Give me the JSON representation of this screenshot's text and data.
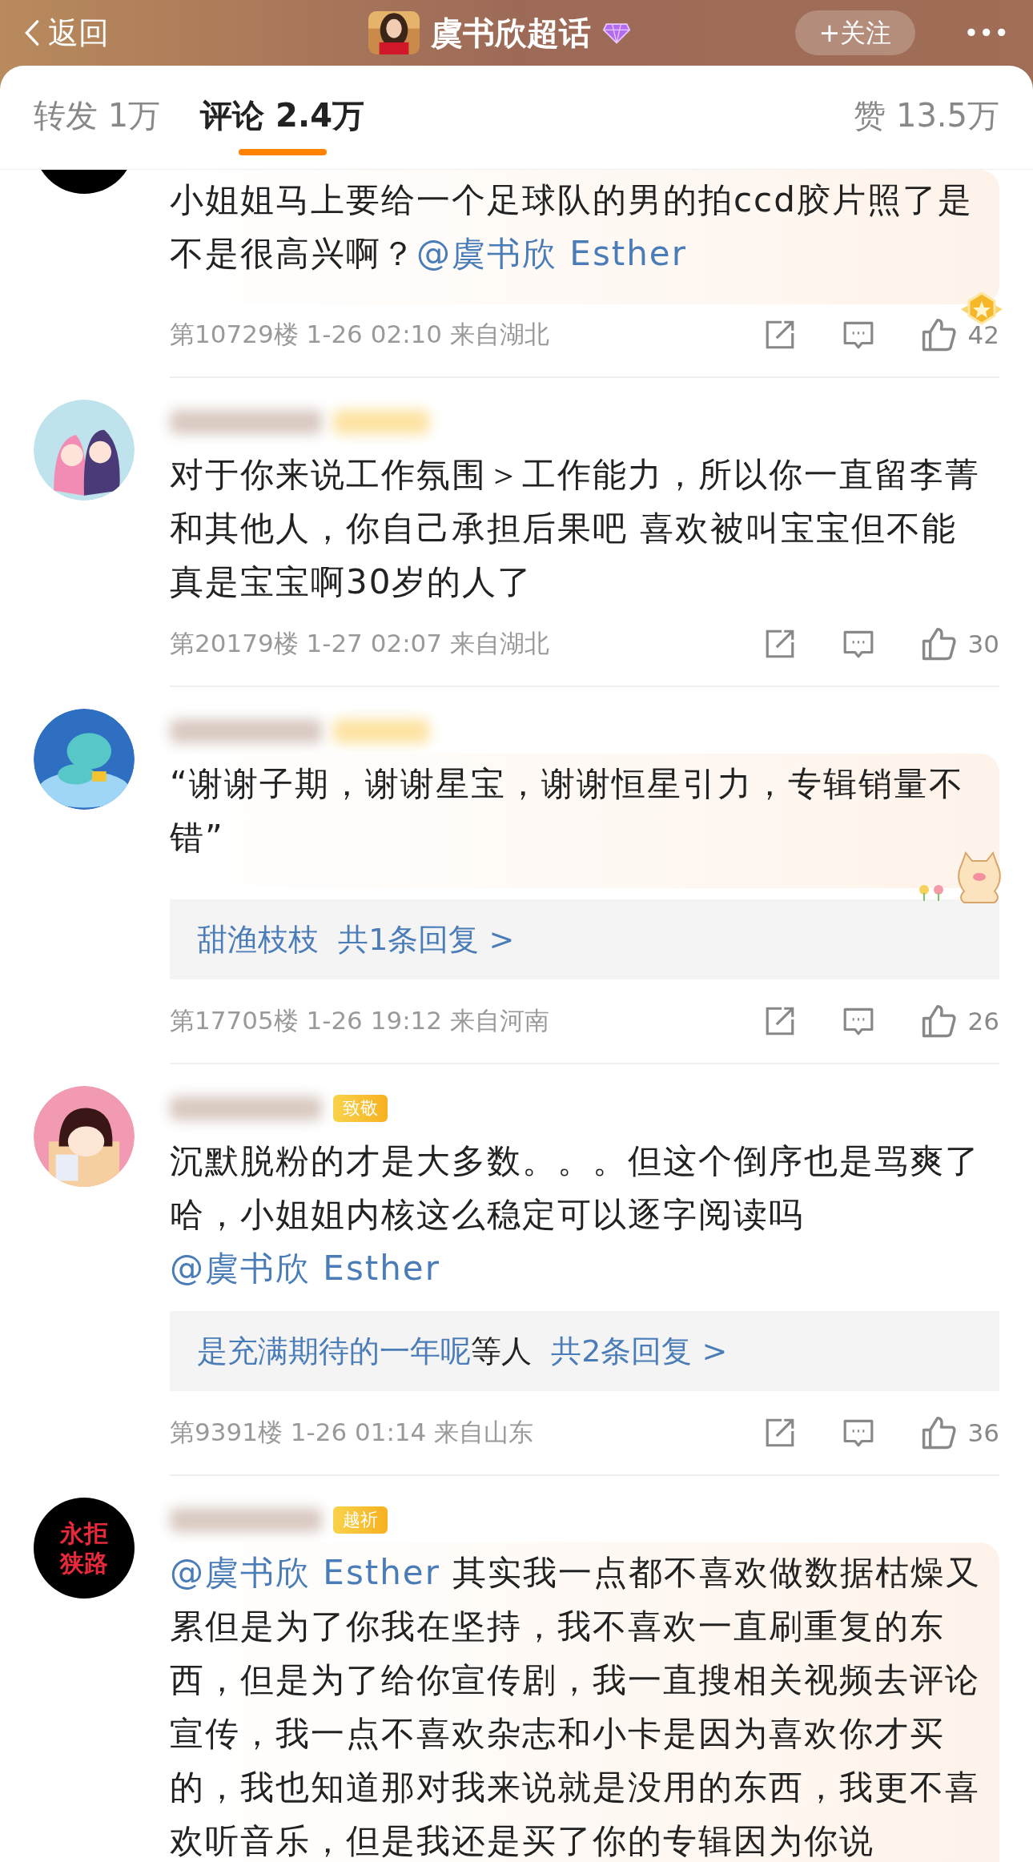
{
  "header": {
    "back_label": "返回",
    "title": "虞书欣超话",
    "follow_label": "+关注",
    "more_label": "•••"
  },
  "tabs": [
    {
      "label": "转发 1万",
      "selected": false
    },
    {
      "label": "评论 2.4万",
      "selected": true
    },
    {
      "label": "赞 13.5万",
      "selected": false
    }
  ],
  "comments": [
    {
      "kind": "scrolled",
      "avatar": {
        "kind": "dark"
      },
      "highlight": true,
      "decoration": {
        "kind": "medal"
      },
      "segments": [
        {
          "kind": "text",
          "text": "小姐姐马上要给一个足球队的男的拍ccd胶片照了是不是很高兴啊？"
        },
        {
          "kind": "mention",
          "text": "@虞书欣 Esther"
        }
      ],
      "meta": "第10729楼 1-26 02:10 来自湖北",
      "likes": "42"
    },
    {
      "kind": "full",
      "avatar": {
        "kind": "anime"
      },
      "highlight": false,
      "segments": [
        {
          "kind": "text",
          "text": "对于你来说工作氛围＞工作能力，所以你一直留李菁和其他人，你自己承担后果吧  喜欢被叫宝宝但不能真是宝宝啊30岁的人了"
        }
      ],
      "meta": "第20179楼 1-27 02:07 来自湖北",
      "likes": "30"
    },
    {
      "kind": "full",
      "avatar": {
        "kind": "blue"
      },
      "highlight": true,
      "decoration": {
        "kind": "cat"
      },
      "segments": [
        {
          "kind": "text",
          "text": "“谢谢子期，谢谢星宝，谢谢恒星引力，专辑销量不错”"
        }
      ],
      "reply": [
        {
          "kind": "link",
          "text": "甜渔枝枝"
        },
        {
          "kind": "link",
          "text": "  共1条回复 >"
        }
      ],
      "meta": "第17705楼 1-26 19:12 来自河南",
      "likes": "26"
    },
    {
      "kind": "full",
      "avatar": {
        "kind": "pink"
      },
      "badge": "致敬",
      "highlight": false,
      "segments": [
        {
          "kind": "text",
          "text": "沉默脱粉的才是大多数。。。但这个倒序也是骂爽了哈，小姐姐内核这么稳定可以逐字阅读吗 "
        },
        {
          "kind": "mention",
          "text": "@虞书欣 Esther"
        }
      ],
      "reply": [
        {
          "kind": "link",
          "text": "是充满期待的一年呢"
        },
        {
          "kind": "text",
          "text": "等人"
        },
        {
          "kind": "link",
          "text": "  共2条回复 >"
        }
      ],
      "meta": "第9391楼 1-26 01:14 来自山东",
      "likes": "36"
    },
    {
      "kind": "full",
      "avatar": {
        "kind": "sign",
        "text": "永拒狭路"
      },
      "badge": "越祈",
      "highlight": true,
      "segments": [
        {
          "kind": "mention",
          "text": "@虞书欣 Esther"
        },
        {
          "kind": "text",
          "text": " 其实我一点都不喜欢做数据枯燥又累但是为了你我在坚持，我不喜欢一直刷重复的东西，但是为了给你宣传剧，我一直搜相关视频去评论宣传，我一点不喜欢杂志和小卡是因为喜欢你才买的，我也知道那对我来说就是没用的东西，我更不喜欢听音乐，但是我还是买了你的专辑因为你说"
        }
      ]
    }
  ]
}
